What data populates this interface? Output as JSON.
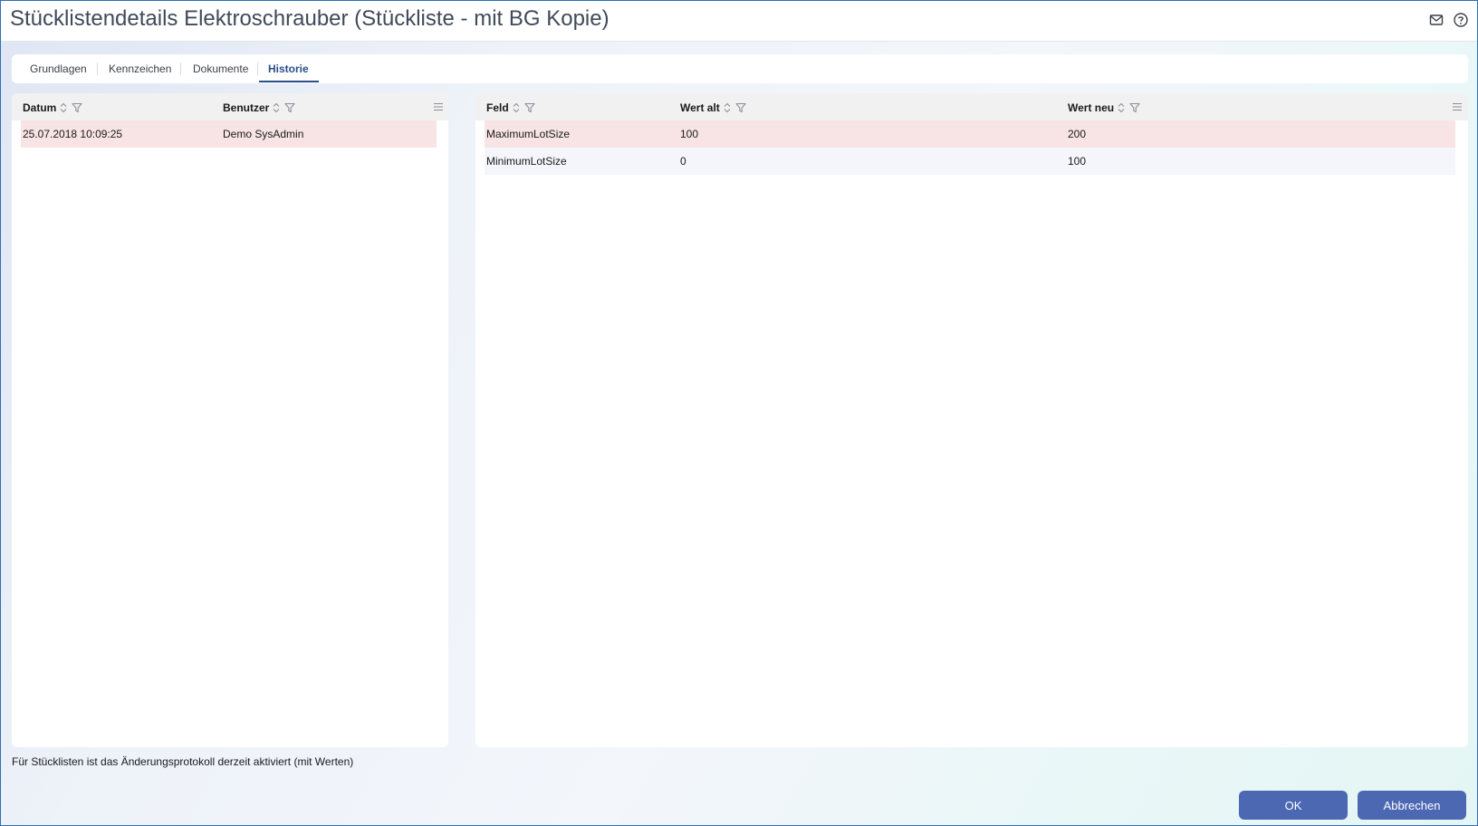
{
  "window": {
    "title": "Stücklistendetails Elektroschrauber (Stückliste - mit BG Kopie)"
  },
  "header_icons": [
    "mail-icon",
    "help-icon"
  ],
  "tabs": [
    {
      "label": "Grundlagen",
      "active": false
    },
    {
      "label": "Kennzeichen",
      "active": false
    },
    {
      "label": "Dokumente",
      "active": false
    },
    {
      "label": "Historie",
      "active": true
    }
  ],
  "history_grid": {
    "columns": [
      "Datum",
      "Benutzer"
    ],
    "rows": [
      {
        "datum": "25.07.2018 10:09:25",
        "benutzer": "Demo SysAdmin",
        "selected": true
      }
    ]
  },
  "detail_grid": {
    "columns": [
      "Feld",
      "Wert alt",
      "Wert neu"
    ],
    "rows": [
      {
        "feld": "MaximumLotSize",
        "wert_alt": "100",
        "wert_neu": "200",
        "selected": true
      },
      {
        "feld": "MinimumLotSize",
        "wert_alt": "0",
        "wert_neu": "100",
        "selected": false
      }
    ]
  },
  "status": {
    "text": "Für Stücklisten ist das Änderungsprotokoll derzeit aktiviert (mit Werten)"
  },
  "buttons": {
    "ok": "OK",
    "cancel": "Abbrechen"
  },
  "colors": {
    "accent": "#4c68b3",
    "active_tab": "#2b4f8a",
    "selected_row": "#f8e4e4",
    "header_bg": "#f1f1f1"
  }
}
